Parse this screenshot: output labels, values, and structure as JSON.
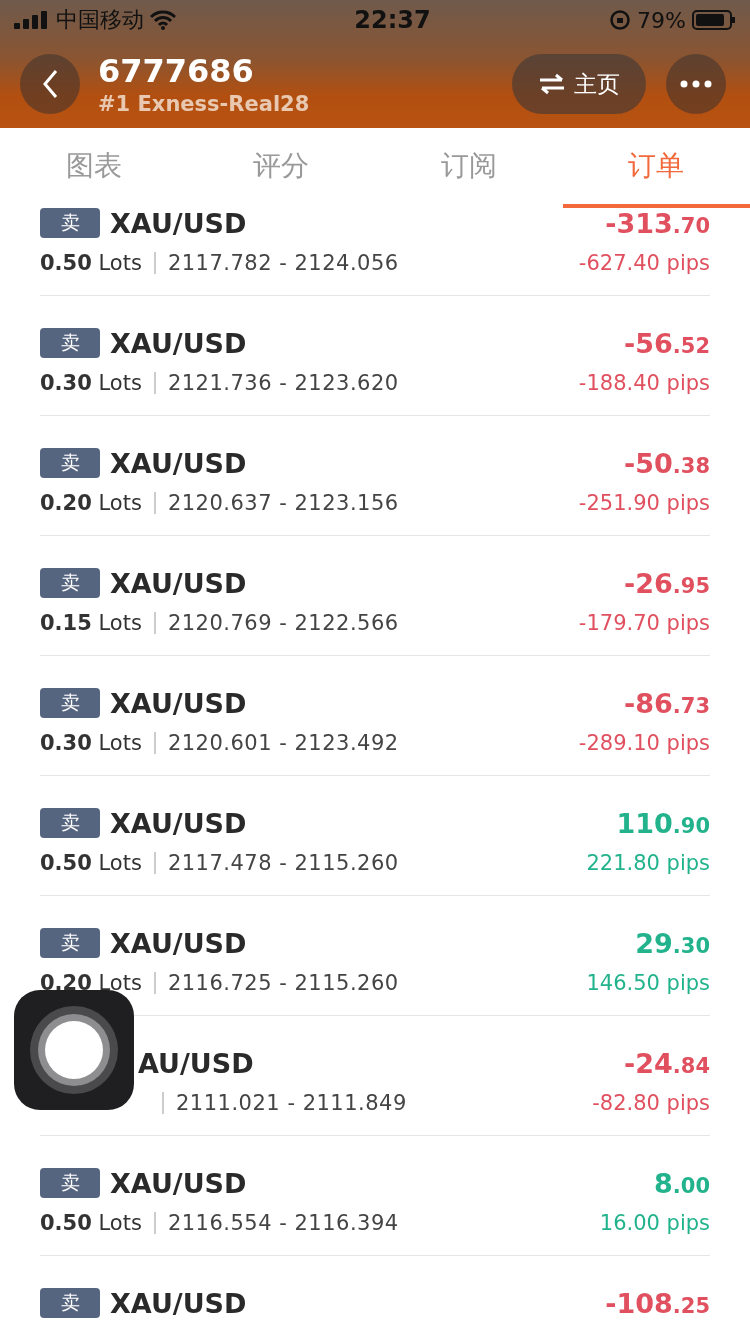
{
  "status_bar": {
    "carrier": "中国移动",
    "time": "22:37",
    "battery": "79%"
  },
  "header": {
    "title": "6777686",
    "subtitle": "#1 Exness-Real28",
    "home_button": "主页"
  },
  "tabs": [
    {
      "label": "图表",
      "selected": false
    },
    {
      "label": "评分",
      "selected": false
    },
    {
      "label": "订阅",
      "selected": false
    },
    {
      "label": "订单",
      "selected": true
    }
  ],
  "orders": [
    {
      "side": "卖",
      "symbol": "XAU/USD",
      "lots": "0.50",
      "lots_unit": "Lots",
      "range": "2117.782 - 2124.056",
      "pnl": "-313.70",
      "pips": "-627.40 pips",
      "color": "#e0505f"
    },
    {
      "side": "卖",
      "symbol": "XAU/USD",
      "lots": "0.30",
      "lots_unit": "Lots",
      "range": "2121.736 - 2123.620",
      "pnl": "-56.52",
      "pips": "-188.40 pips",
      "color": "#e0505f"
    },
    {
      "side": "卖",
      "symbol": "XAU/USD",
      "lots": "0.20",
      "lots_unit": "Lots",
      "range": "2120.637 - 2123.156",
      "pnl": "-50.38",
      "pips": "-251.90 pips",
      "color": "#e0505f"
    },
    {
      "side": "卖",
      "symbol": "XAU/USD",
      "lots": "0.15",
      "lots_unit": "Lots",
      "range": "2120.769 - 2122.566",
      "pnl": "-26.95",
      "pips": "-179.70 pips",
      "color": "#e0505f"
    },
    {
      "side": "卖",
      "symbol": "XAU/USD",
      "lots": "0.30",
      "lots_unit": "Lots",
      "range": "2120.601 - 2123.492",
      "pnl": "-86.73",
      "pips": "-289.10 pips",
      "color": "#e0505f"
    },
    {
      "side": "卖",
      "symbol": "XAU/USD",
      "lots": "0.50",
      "lots_unit": "Lots",
      "range": "2117.478 - 2115.260",
      "pnl": "110.90",
      "pips": "221.80 pips",
      "color": "#22b38c"
    },
    {
      "side": "卖",
      "symbol": "XAU/USD",
      "lots": "0.20",
      "lots_unit": "Lots",
      "range": "2116.725 - 2115.260",
      "pnl": "29.30",
      "pips": "146.50 pips",
      "color": "#22b38c"
    },
    {
      "symbol": "AU/USD",
      "range": "2111.021 - 2111.849",
      "pnl": "-24.84",
      "pips": "-82.80 pips",
      "color": "#e0505f"
    },
    {
      "side": "卖",
      "symbol": "XAU/USD",
      "lots": "0.50",
      "lots_unit": "Lots",
      "range": "2116.554 - 2116.394",
      "pnl": "8.00",
      "pips": "16.00 pips",
      "color": "#22b38c"
    },
    {
      "side": "卖",
      "symbol": "XAU/USD",
      "pnl": "-108.25",
      "color": "#e0505f"
    }
  ]
}
